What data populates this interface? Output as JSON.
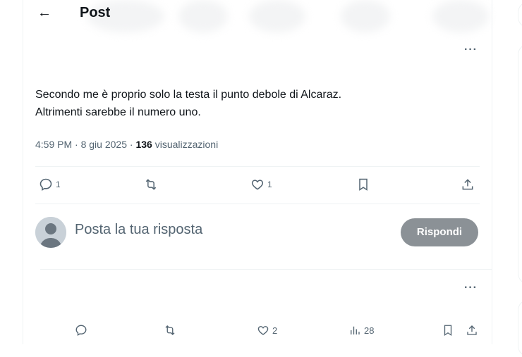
{
  "header": {
    "back_icon": "arrow-left-icon",
    "title": "Post",
    "back_glyph": "←"
  },
  "post": {
    "text_line1": "Secondo me è proprio solo la testa il punto debole di Alcaraz.",
    "text_line2": "Altrimenti sarebbe il numero uno.",
    "time": "4:59 PM",
    "date": "8 giu 2025",
    "views_count": "136",
    "views_label": "visualizzazioni",
    "more_glyph": "···",
    "actions": {
      "replies": "1",
      "likes": "1"
    }
  },
  "reply": {
    "placeholder": "Posta la tua risposta",
    "button_label": "Rispondi"
  },
  "next_post": {
    "more_glyph": "···",
    "likes": "2",
    "views": "28"
  },
  "colors": {
    "text": "#0f1419",
    "secondary": "#536471",
    "reply_button": "#8b9196",
    "border": "#eff3f4"
  }
}
